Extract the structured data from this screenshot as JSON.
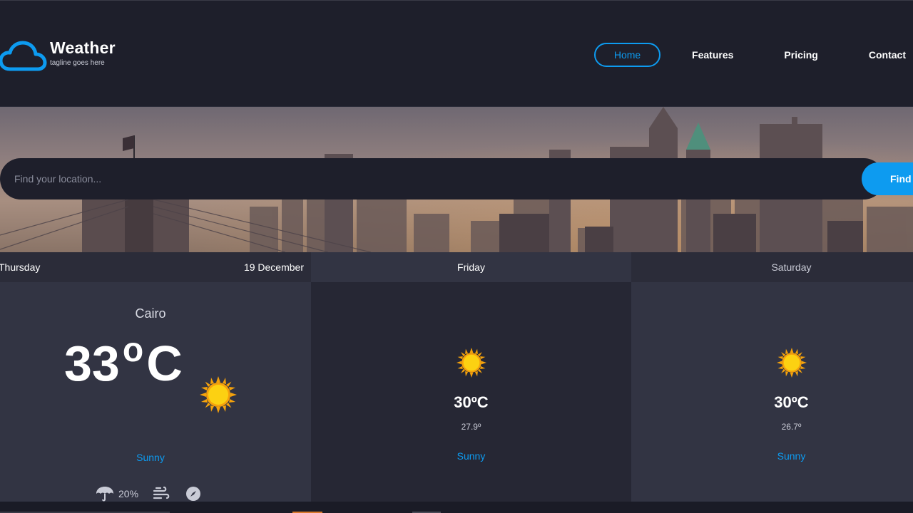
{
  "brand": {
    "title": "Weather",
    "tagline": "tagline goes here",
    "icon": "cloud-icon",
    "accent": "#0d9bf0"
  },
  "nav": {
    "items": [
      {
        "label": "Home",
        "active": true
      },
      {
        "label": "Features",
        "active": false
      },
      {
        "label": "Pricing",
        "active": false
      },
      {
        "label": "Contact",
        "active": false
      }
    ]
  },
  "search": {
    "placeholder": "Find your location...",
    "button_label": "Find"
  },
  "today": {
    "day": "Thursday",
    "date": "19 December",
    "location": "Cairo",
    "temp": "33",
    "deg_symbol": "o",
    "unit": "C",
    "condition": "Sunny",
    "icon": "sun-icon",
    "precipitation": "20%",
    "meta_icons": [
      "umbrella-icon",
      "wind-icon",
      "compass-icon"
    ]
  },
  "forecast": [
    {
      "day": "Friday",
      "high": "30ºC",
      "low": "27.9º",
      "condition": "Sunny",
      "icon": "sun-icon"
    },
    {
      "day": "Saturday",
      "high": "30ºC",
      "low": "26.7º",
      "condition": "Sunny",
      "icon": "sun-icon"
    }
  ]
}
